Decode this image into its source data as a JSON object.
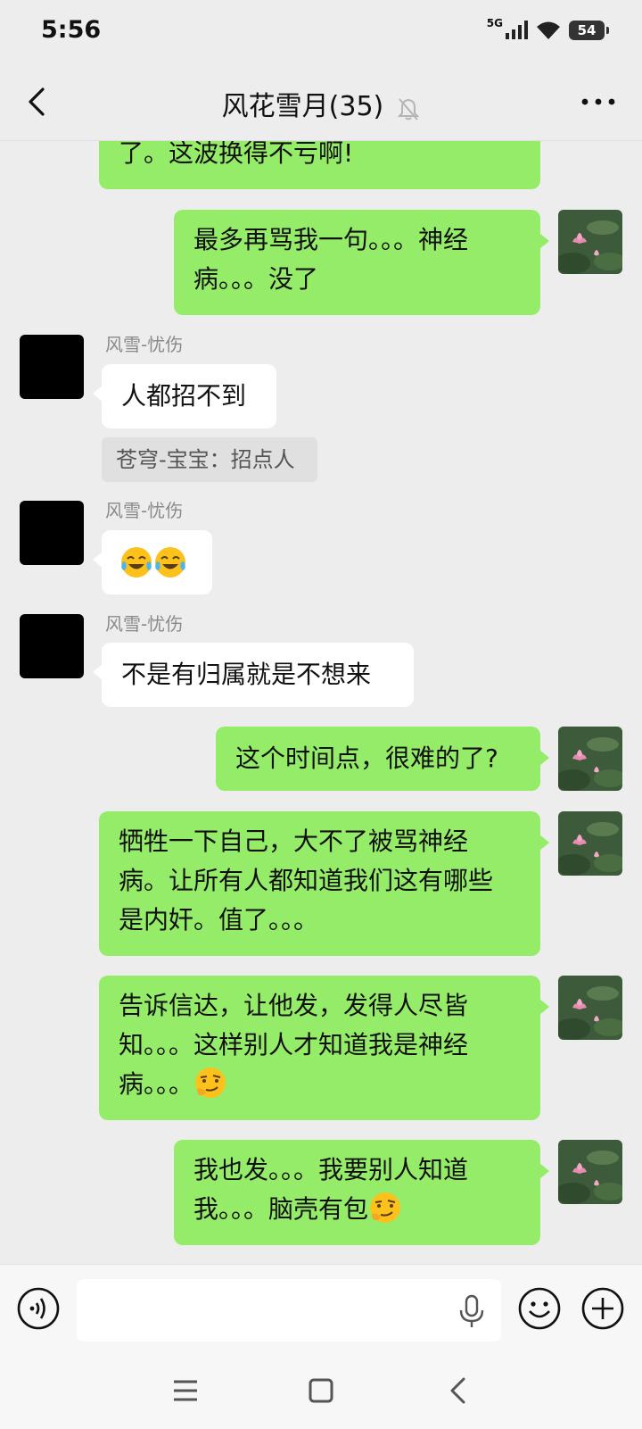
{
  "status_bar": {
    "time": "5:56",
    "network": "5G",
    "battery": "54"
  },
  "header": {
    "title": "风花雪月(35)",
    "muted_icon": "bell-off-icon",
    "more_icon": "more-dots-icon",
    "back_icon": "chevron-left-icon"
  },
  "messages": [
    {
      "side": "me",
      "text": "了。这波换得不亏啊!"
    },
    {
      "side": "me",
      "text": "最多再骂我一句。。。神经病。。。没了"
    },
    {
      "side": "other",
      "sender": "风雪-忧伤",
      "text": "人都招不到",
      "quote": "苍穹-宝宝：招点人"
    },
    {
      "side": "other",
      "sender": "风雪-忧伤",
      "emoji": [
        "tears-of-joy-emoji",
        "tears-of-joy-emoji"
      ]
    },
    {
      "side": "other",
      "sender": "风雪-忧伤",
      "text": "不是有归属就是不想来"
    },
    {
      "side": "me",
      "text": "这个时间点，很难的了?"
    },
    {
      "side": "me",
      "text_lines": [
        "牺牲一下自己，大不了被骂神经",
        "病。让所有人都知道我们这有哪些",
        "是内奸。值了。。。"
      ]
    },
    {
      "side": "me",
      "text_lines": [
        "告诉信达，让他发，发得人尽皆",
        "知。。。这样别人才知道我是神经",
        "病。。。"
      ],
      "trailing_emoji": "smirk-emoji"
    },
    {
      "side": "me",
      "text_lines": [
        "我也发。。。我要别人知道",
        "我。。。脑壳有包"
      ],
      "trailing_emoji": "smirk-emoji"
    }
  ],
  "input_bar": {
    "voice_icon": "voice-mode-icon",
    "placeholder": "",
    "mic_icon": "microphone-icon",
    "emoji_icon": "emoji-face-icon",
    "plus_icon": "plus-circle-icon"
  },
  "nav_bar": {
    "menu_icon": "menu-lines-icon",
    "home_icon": "home-square-icon",
    "back_icon": "nav-back-icon"
  },
  "colors": {
    "my_bubble": "#95ec69",
    "other_bubble": "#ffffff",
    "background": "#ededed"
  }
}
